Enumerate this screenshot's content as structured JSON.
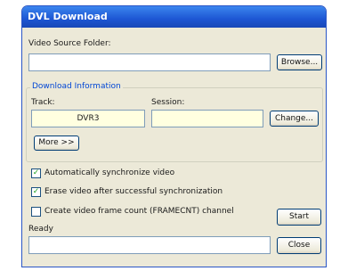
{
  "window": {
    "title": "DVL Download"
  },
  "video_source": {
    "label": "Video Source Folder:",
    "value": "",
    "browse_label": "Browse..."
  },
  "download_info": {
    "title": "Download Information",
    "track_label": "Track:",
    "track_value": "DVR3",
    "session_label": "Session:",
    "session_value": "",
    "change_label": "Change...",
    "more_label": "More >>"
  },
  "options": [
    {
      "label": "Automatically synchronize video",
      "checked": true
    },
    {
      "label": "Erase video after successful synchronization",
      "checked": true
    },
    {
      "label": "Create video frame count (FRAMECNT) channel",
      "checked": false
    }
  ],
  "status": {
    "label": "Ready",
    "value": ""
  },
  "actions": {
    "start_label": "Start",
    "close_label": "Close"
  }
}
